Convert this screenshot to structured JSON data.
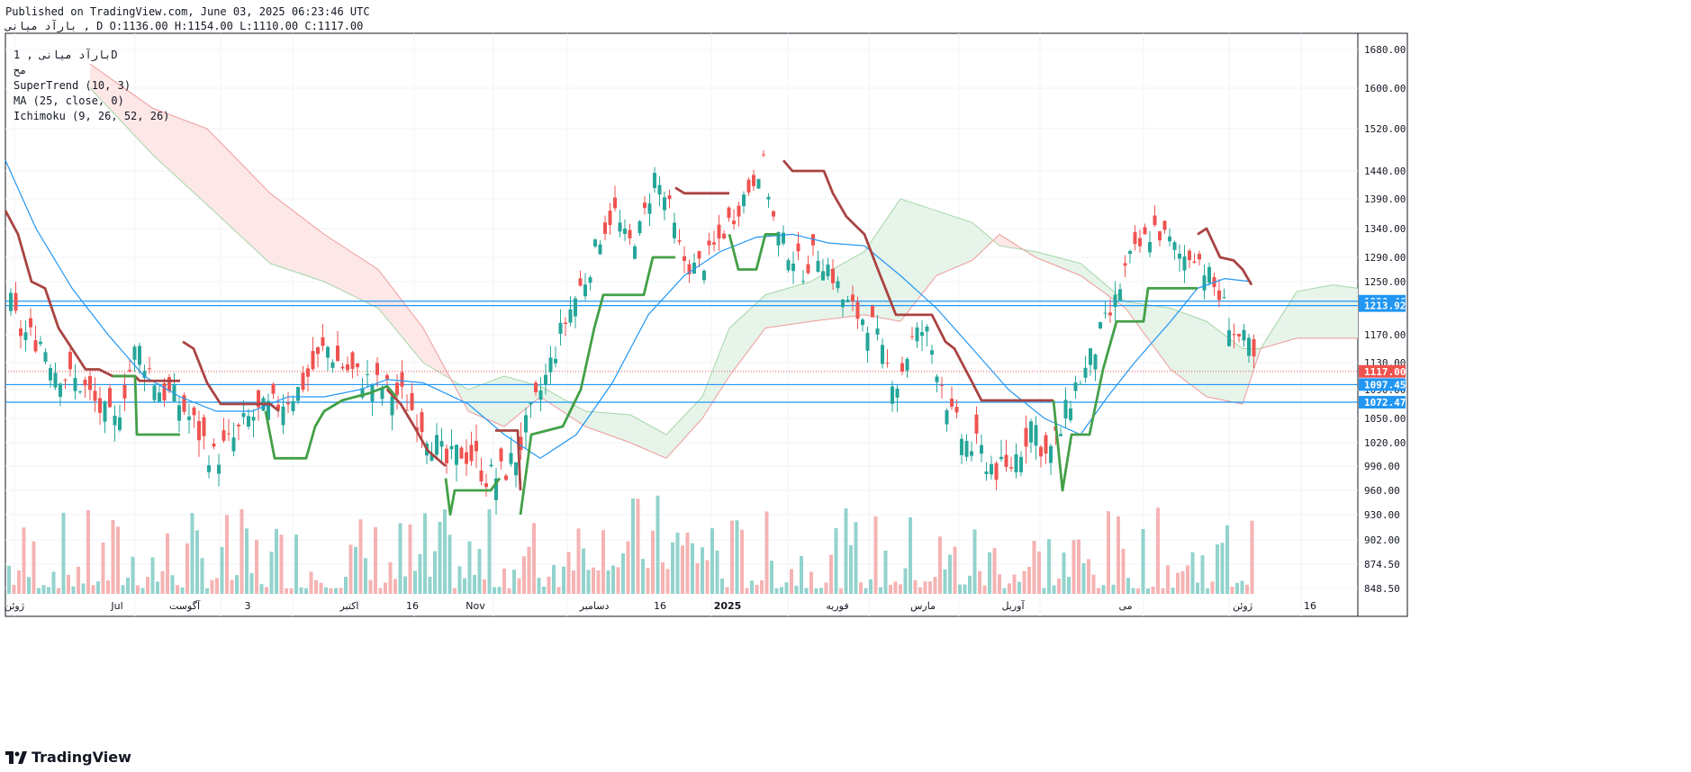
{
  "header": {
    "published": "Published on TradingView.com, June 03, 2025 06:23:46 UTC",
    "symbol_line": "بارآد  میانی , D O:1136.00 H:1154.00 L:1110.00 C:1117.00"
  },
  "legend": {
    "symbol": "بارآد  میانی , 1D",
    "sub": "مح",
    "indicators": [
      "SuperTrend (10, 3)",
      "MA (25, close, 0)",
      "Ichimoku (9, 26, 52, 26)"
    ]
  },
  "branding": {
    "logo_text": "TradingView"
  },
  "colors": {
    "up": "#26a69a",
    "down": "#ef5350",
    "supertrend_up": "#43a047",
    "supertrend_down": "#a94442",
    "ma": "#2196f3",
    "cloud_bull": "#c8e6c9",
    "cloud_bear": "#ffcdd2",
    "hline": "#2196f3",
    "last_price": "#ef5350"
  },
  "chart_data": {
    "type": "candlestick",
    "y_ticks": [
      848.5,
      874.5,
      902,
      930,
      960,
      990,
      1020,
      1050,
      1090,
      1130,
      1170,
      1250,
      1290,
      1340,
      1390,
      1440,
      1520,
      1600,
      1680
    ],
    "y_tick_labels": [
      "848.50",
      "874.50",
      "902.00",
      "930.00",
      "960.00",
      "990.00",
      "1020.00",
      "1050.00",
      "1090.00",
      "1130.00",
      "1170.00",
      "1250.00",
      "1290.00",
      "1340.00",
      "1390.00",
      "1440.00",
      "1520.00",
      "1600.00",
      "1680.00"
    ],
    "x_labels": [
      "ژوئن",
      "Jul",
      "آگوست",
      "3",
      "اکتبر",
      "16",
      "Nov",
      "دسامبر",
      "16",
      "2025",
      "فوریه",
      "مارس",
      "آوریل",
      "می",
      "ژوئن",
      "16"
    ],
    "bold_x_label": "2025",
    "price_labels": [
      {
        "value": 1220.46,
        "label": "1220.46",
        "kind": "hline"
      },
      {
        "value": 1213.92,
        "label": "1213.92",
        "kind": "hline"
      },
      {
        "value": 1117.0,
        "label": "1117.00",
        "kind": "last"
      },
      {
        "value": 1097.45,
        "label": "1097.45",
        "kind": "hline"
      },
      {
        "value": 1072.47,
        "label": "1072.47",
        "kind": "hline"
      }
    ],
    "last": {
      "open": 1136,
      "high": 1154,
      "low": 1110,
      "close": 1117
    }
  }
}
